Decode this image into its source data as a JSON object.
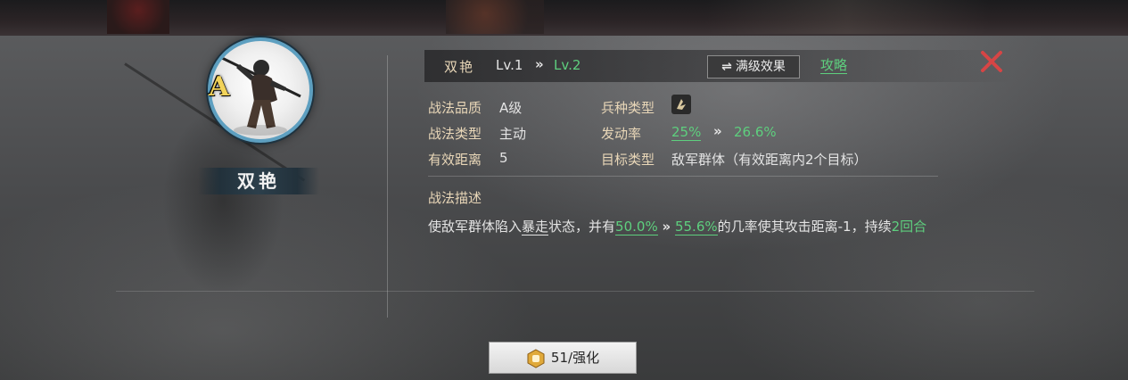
{
  "skill": {
    "name": "双艳",
    "grade_badge": "A",
    "level_current": "Lv.1",
    "level_arrow": "»",
    "level_next": "Lv.2"
  },
  "header": {
    "max_effect_icon": "swap-arrows-icon",
    "max_effect_label": "满级效果",
    "guide_label": "攻略"
  },
  "attributes": {
    "quality_label": "战法品质",
    "quality_value": "A级",
    "troop_type_label": "兵种类型",
    "troop_type_icon": "troop-type-icon",
    "skill_type_label": "战法类型",
    "skill_type_value": "主动",
    "trigger_rate_label": "发动率",
    "trigger_rate_current": "25%",
    "trigger_rate_arrow": "»",
    "trigger_rate_next": "26.6%",
    "range_label": "有效距离",
    "range_value": "5",
    "target_label": "目标类型",
    "target_value": "敌军群体（有效距离内2个目标）"
  },
  "description": {
    "title": "战法描述",
    "part1": "使敌军群体陷入",
    "keyword": "暴走",
    "part2": "状态，并有",
    "chance_current": "50.0%",
    "chance_arrow": "»",
    "chance_next": "55.6%",
    "part3": "的几率使其攻击距离-1，持续",
    "duration": "2回合"
  },
  "enhance": {
    "icon": "fist-icon",
    "label": "51/强化"
  },
  "colors": {
    "green": "#5ecf7e",
    "label_gold": "#e9d7b8",
    "close_red": "#d64545",
    "grade_yellow": "#f2d35a",
    "portrait_ring": "#5d9fc0"
  }
}
